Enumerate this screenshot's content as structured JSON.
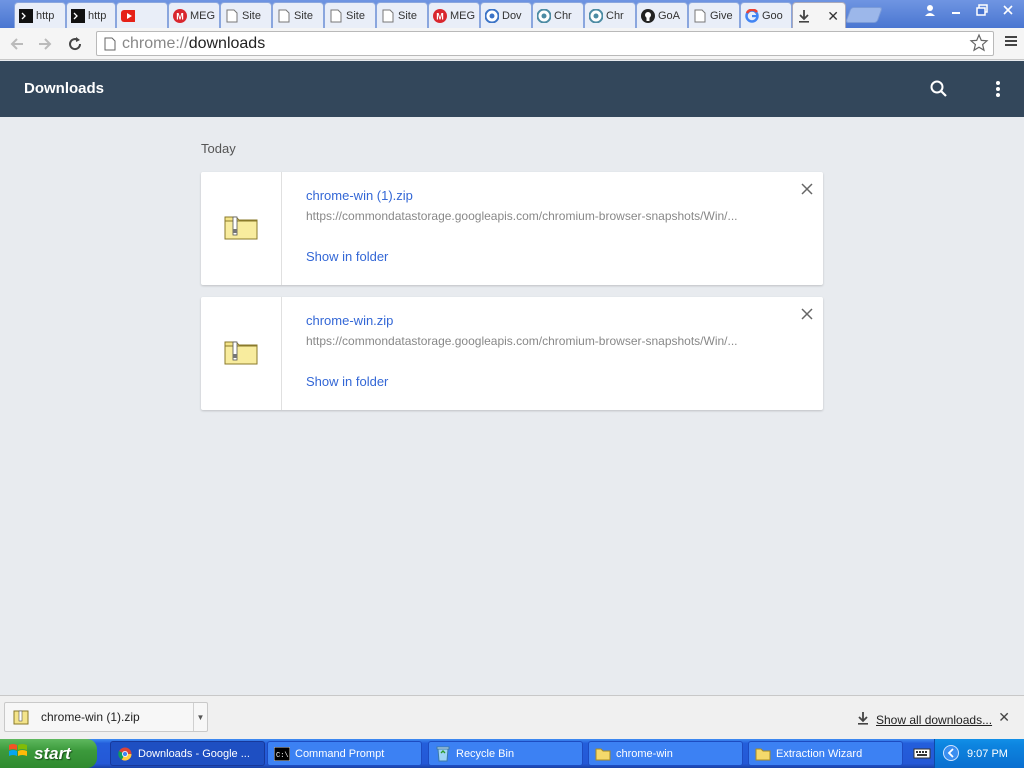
{
  "tabs": [
    {
      "label": "http",
      "icon": "terminal-icon"
    },
    {
      "label": "http",
      "icon": "terminal-icon"
    },
    {
      "label": "",
      "icon": "youtube-icon"
    },
    {
      "label": "MEG",
      "icon": "mega-icon"
    },
    {
      "label": "Site",
      "icon": "page-icon"
    },
    {
      "label": "Site",
      "icon": "page-icon"
    },
    {
      "label": "Site",
      "icon": "page-icon"
    },
    {
      "label": "Site",
      "icon": "page-icon"
    },
    {
      "label": "MEG",
      "icon": "mega-icon"
    },
    {
      "label": "Dov",
      "icon": "chrome-icon"
    },
    {
      "label": "Chr",
      "icon": "chromium-icon"
    },
    {
      "label": "Chr",
      "icon": "chromium-icon"
    },
    {
      "label": "GoA",
      "icon": "github-icon"
    },
    {
      "label": "Give",
      "icon": "page-icon"
    },
    {
      "label": "Goo",
      "icon": "google-icon"
    },
    {
      "label": "",
      "icon": "download-icon",
      "active": true
    }
  ],
  "omnibox": {
    "scheme": "chrome://",
    "host": "downloads"
  },
  "header": {
    "title": "Downloads"
  },
  "section": {
    "date_label": "Today"
  },
  "downloads": [
    {
      "file_name": "chrome-win (1).zip",
      "url": "https://commondatastorage.googleapis.com/chromium-browser-snapshots/Win/...",
      "action": "Show in folder"
    },
    {
      "file_name": "chrome-win.zip",
      "url": "https://commondatastorage.googleapis.com/chromium-browser-snapshots/Win/...",
      "action": "Show in folder"
    }
  ],
  "shelf": {
    "item_name": "chrome-win (1).zip",
    "show_all": "Show all downloads..."
  },
  "taskbar": {
    "start_label": "start",
    "buttons": [
      {
        "label": "Downloads - Google ...",
        "icon": "chrome-icon",
        "active": true
      },
      {
        "label": "Command Prompt",
        "icon": "cmd-icon"
      },
      {
        "label": "Recycle Bin",
        "icon": "recycle-bin-icon"
      },
      {
        "label": "chrome-win",
        "icon": "folder-icon"
      },
      {
        "label": "Extraction Wizard",
        "icon": "folder-icon"
      }
    ],
    "clock": "9:07 PM"
  },
  "colors": {
    "header_bg": "#33475b",
    "link_blue": "#3367d6",
    "page_bg": "#e8ebef",
    "taskbar_blue": "#245edb",
    "start_green": "#3c9a3c"
  }
}
